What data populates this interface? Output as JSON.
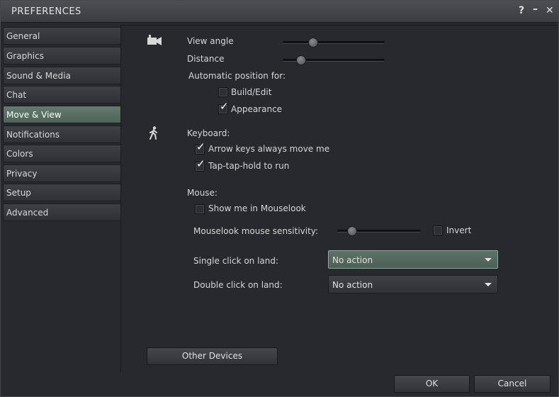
{
  "window": {
    "title": "PREFERENCES",
    "help_glyph": "?",
    "minimize_glyph": "–",
    "close_glyph": "✕"
  },
  "sidebar": {
    "items": [
      {
        "label": "General"
      },
      {
        "label": "Graphics"
      },
      {
        "label": "Sound & Media"
      },
      {
        "label": "Chat"
      },
      {
        "label": "Move & View",
        "active": true
      },
      {
        "label": "Notifications"
      },
      {
        "label": "Colors"
      },
      {
        "label": "Privacy"
      },
      {
        "label": "Setup"
      },
      {
        "label": "Advanced"
      }
    ]
  },
  "camera": {
    "icon": "camera-icon",
    "view_angle_label": "View angle",
    "view_angle_value": 0.3,
    "distance_label": "Distance",
    "distance_value": 0.18,
    "auto_position_label": "Automatic position for:",
    "build_edit_label": "Build/Edit",
    "build_edit_checked": false,
    "appearance_label": "Appearance",
    "appearance_checked": true
  },
  "keyboard": {
    "icon": "walking-person-icon",
    "label": "Keyboard:",
    "arrow_keys_label": "Arrow keys always move me",
    "arrow_keys_checked": true,
    "tap_hold_label": "Tap-tap-hold to run",
    "tap_hold_checked": true
  },
  "mouse": {
    "label": "Mouse:",
    "mouselook_label": "Show me in Mouselook",
    "mouselook_checked": false,
    "sensitivity_label": "Mouselook mouse sensitivity:",
    "sensitivity_value": 0.18,
    "invert_label": "Invert",
    "invert_checked": false,
    "single_click_label": "Single click on land:",
    "single_click_value": "No action",
    "double_click_label": "Double click on land:",
    "double_click_value": "No action"
  },
  "buttons": {
    "other_devices": "Other Devices",
    "ok": "OK",
    "cancel": "Cancel"
  },
  "colors": {
    "accent": "#5a6f64",
    "background": "#28292e"
  }
}
